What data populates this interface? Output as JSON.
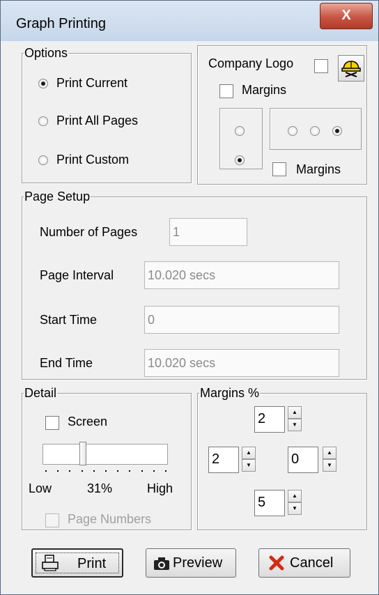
{
  "window": {
    "title": "Graph Printing",
    "close_label": "X"
  },
  "options": {
    "legend": "Options",
    "radios": [
      {
        "label": "Print Current",
        "selected": true
      },
      {
        "label": "Print All Pages",
        "selected": false
      },
      {
        "label": "Print Custom",
        "selected": false
      }
    ]
  },
  "logo": {
    "company_logo_label": "Company Logo",
    "company_logo_checked": false,
    "margins_label_top": "Margins",
    "margins_top_checked": false,
    "vertical_positions": [
      false,
      true
    ],
    "horizontal_positions": [
      false,
      false,
      true
    ],
    "margins_label_bottom": "Margins",
    "margins_bottom_checked": false,
    "logo_icon": "hardhat-icon"
  },
  "page_setup": {
    "legend": "Page Setup",
    "num_pages_label": "Number of Pages",
    "num_pages_value": "1",
    "page_interval_label": "Page Interval",
    "page_interval_value": "10.020 secs",
    "start_time_label": "Start Time",
    "start_time_value": "0",
    "end_time_label": "End Time",
    "end_time_value": "10.020 secs"
  },
  "detail": {
    "legend": "Detail",
    "screen_label": "Screen",
    "screen_checked": false,
    "slider_low": "Low",
    "slider_value": "31%",
    "slider_high": "High",
    "slider_fraction": 0.31,
    "page_numbers_label": "Page Numbers",
    "page_numbers_enabled": false
  },
  "margins": {
    "legend": "Margins %",
    "top": "2",
    "left": "2",
    "right": "0",
    "bottom": "5"
  },
  "buttons": {
    "print": "Print",
    "preview": "Preview",
    "cancel": "Cancel",
    "print_icon": "printer-icon",
    "preview_icon": "camera-icon",
    "cancel_icon": "red-x-icon",
    "cancel_icon_color": "#d42a12"
  }
}
